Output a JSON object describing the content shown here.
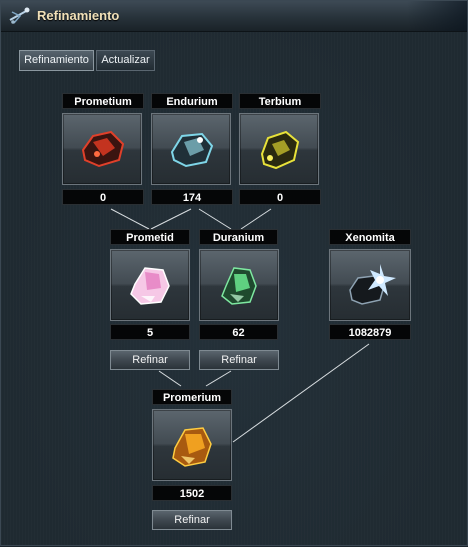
{
  "window": {
    "title": "Refinamiento"
  },
  "tabs": [
    {
      "label": "Refinamiento"
    },
    {
      "label": "Actualizar"
    }
  ],
  "materials": {
    "prometium": {
      "name": "Prometium",
      "amount": "0",
      "color": "#e0402a"
    },
    "endurium": {
      "name": "Endurium",
      "amount": "174",
      "color": "#7fd6e8"
    },
    "terbium": {
      "name": "Terbium",
      "amount": "0",
      "color": "#e8e23a"
    },
    "prometid": {
      "name": "Prometid",
      "amount": "5",
      "color": "#f0a8d8"
    },
    "duranium": {
      "name": "Duranium",
      "amount": "62",
      "color": "#7ee8a0"
    },
    "xenomita": {
      "name": "Xenomita",
      "amount": "1082879",
      "color": "#cfe9ff"
    },
    "promerium": {
      "name": "Promerium",
      "amount": "1502",
      "color": "#f0a020"
    }
  },
  "buttons": {
    "refine_prometid": "Refinar",
    "refine_duranium": "Refinar",
    "refine_promerium": "Refinar"
  }
}
